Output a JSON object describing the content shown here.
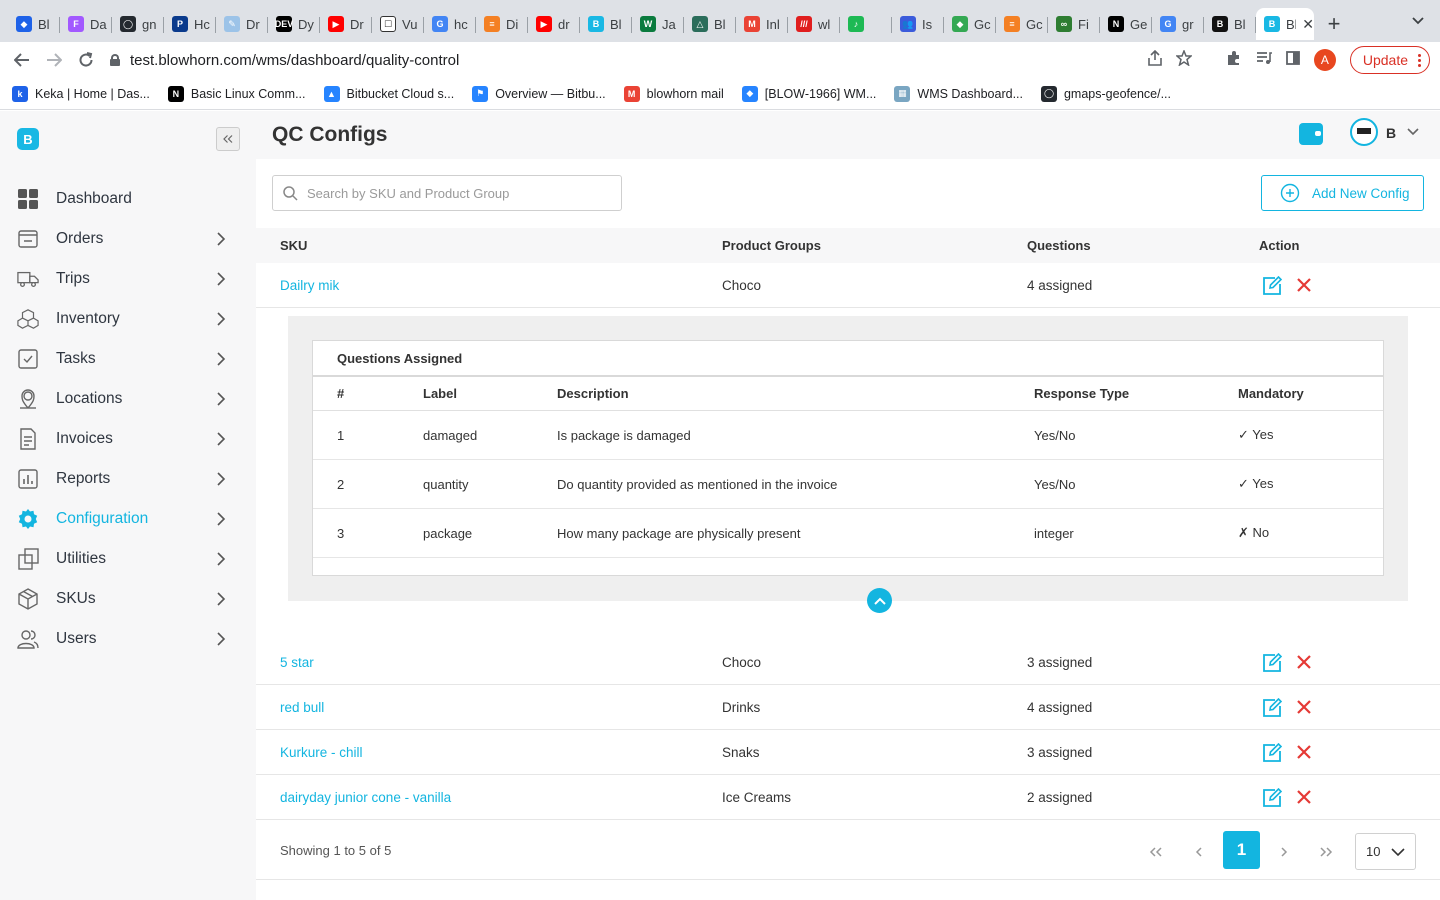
{
  "browser": {
    "tabs": [
      {
        "title": "Bl",
        "color": "#1e62e8",
        "glyph": "◆"
      },
      {
        "title": "Da",
        "color": "#a259ff",
        "glyph": "F"
      },
      {
        "title": "gn",
        "color": "#24292f",
        "glyph": "◯"
      },
      {
        "title": "Hc",
        "color": "#0a3a8c",
        "glyph": "P"
      },
      {
        "title": "Dr",
        "color": "#9cc3e8",
        "glyph": "✎"
      },
      {
        "title": "Dy",
        "color": "#000000",
        "glyph": "DEV"
      },
      {
        "title": "Dr",
        "color": "#ff0000",
        "glyph": "▶"
      },
      {
        "title": "Vu",
        "color": "#ffffff",
        "glyph": "☐"
      },
      {
        "title": "hc",
        "color": "#4285f4",
        "glyph": "G"
      },
      {
        "title": "Di",
        "color": "#f48024",
        "glyph": "≡"
      },
      {
        "title": "dr",
        "color": "#ff0000",
        "glyph": "▶"
      },
      {
        "title": "Bl",
        "color": "#19b8e4",
        "glyph": "B"
      },
      {
        "title": "Ja",
        "color": "#0a7b3e",
        "glyph": "W"
      },
      {
        "title": "Bl",
        "color": "#2b6d5b",
        "glyph": "△"
      },
      {
        "title": "Inl",
        "color": "#ea4335",
        "glyph": "M"
      },
      {
        "title": "wl",
        "color": "#e01e1e",
        "glyph": "///"
      },
      {
        "title": "",
        "color": "#1db954",
        "glyph": "♪"
      },
      {
        "title": "Is",
        "color": "#3b5bdb",
        "glyph": "👥"
      },
      {
        "title": "Gc",
        "color": "#34a853",
        "glyph": "◆"
      },
      {
        "title": "Gc",
        "color": "#f48024",
        "glyph": "≡"
      },
      {
        "title": "Fi",
        "color": "#2e7d32",
        "glyph": "∞"
      },
      {
        "title": "Ge",
        "color": "#000000",
        "glyph": "N"
      },
      {
        "title": "gr",
        "color": "#4285f4",
        "glyph": "G"
      },
      {
        "title": "Bl",
        "color": "#111111",
        "glyph": "B"
      },
      {
        "title": "Bl",
        "color": "#19b8e4",
        "glyph": "B",
        "active": true
      }
    ],
    "url": "test.blowhorn.com/wms/dashboard/quality-control",
    "profile_initial": "A",
    "update_label": "Update",
    "bookmarks": [
      {
        "label": "Keka | Home | Das...",
        "color": "#1e62e8",
        "glyph": "k"
      },
      {
        "label": "Basic Linux Comm...",
        "color": "#000000",
        "glyph": "N"
      },
      {
        "label": "Bitbucket Cloud s...",
        "color": "#2684ff",
        "glyph": "▲"
      },
      {
        "label": "Overview — Bitbu...",
        "color": "#2684ff",
        "glyph": "⚑"
      },
      {
        "label": "blowhorn mail",
        "color": "#ea4335",
        "glyph": "M"
      },
      {
        "label": "[BLOW-1966] WM...",
        "color": "#2684ff",
        "glyph": "◆"
      },
      {
        "label": "WMS Dashboard...",
        "color": "#7aa6c2",
        "glyph": "▦"
      },
      {
        "label": "gmaps-geofence/...",
        "color": "#24292f",
        "glyph": "◯"
      }
    ]
  },
  "sidebar": {
    "logo": "B",
    "items": [
      {
        "label": "Dashboard",
        "icon": "dashboard-icon",
        "chevron": false
      },
      {
        "label": "Orders",
        "icon": "orders-icon",
        "chevron": true
      },
      {
        "label": "Trips",
        "icon": "truck-icon",
        "chevron": true
      },
      {
        "label": "Inventory",
        "icon": "boxes-icon",
        "chevron": true
      },
      {
        "label": "Tasks",
        "icon": "tasks-icon",
        "chevron": true
      },
      {
        "label": "Locations",
        "icon": "location-icon",
        "chevron": true
      },
      {
        "label": "Invoices",
        "icon": "invoice-icon",
        "chevron": true
      },
      {
        "label": "Reports",
        "icon": "reports-icon",
        "chevron": true
      },
      {
        "label": "Configuration",
        "icon": "gear-icon",
        "chevron": true,
        "active": true
      },
      {
        "label": "Utilities",
        "icon": "utilities-icon",
        "chevron": true
      },
      {
        "label": "SKUs",
        "icon": "package-icon",
        "chevron": true
      },
      {
        "label": "Users",
        "icon": "users-icon",
        "chevron": true
      }
    ]
  },
  "header": {
    "title": "QC Configs",
    "user_initial": "B"
  },
  "search": {
    "placeholder": "Search by SKU and Product Group",
    "value": ""
  },
  "add_button_label": "Add New Config",
  "table": {
    "columns": [
      "SKU",
      "Product Groups",
      "Questions",
      "Action"
    ],
    "rows": [
      {
        "sku": "Dailry mik",
        "group": "Choco",
        "questions": "4 assigned",
        "expanded": true
      },
      {
        "sku": "5 star",
        "group": "Choco",
        "questions": "3 assigned"
      },
      {
        "sku": "red bull",
        "group": "Drinks",
        "questions": "4 assigned"
      },
      {
        "sku": "Kurkure - chill",
        "group": "Snaks",
        "questions": "3 assigned"
      },
      {
        "sku": "dairyday junior cone - vanilla",
        "group": "Ice Creams",
        "questions": "2 assigned"
      }
    ]
  },
  "questions_assigned": {
    "title": "Questions Assigned",
    "columns": [
      "#",
      "Label",
      "Description",
      "Response Type",
      "Mandatory"
    ],
    "rows": [
      {
        "num": "1",
        "label": "damaged",
        "description": "Is package is damaged",
        "response": "Yes/No",
        "mandatory": "✓ Yes"
      },
      {
        "num": "2",
        "label": "quantity",
        "description": "Do quantity provided as mentioned in the invoice",
        "response": "Yes/No",
        "mandatory": "✓ Yes"
      },
      {
        "num": "3",
        "label": "package",
        "description": "How many package are physically present",
        "response": "integer",
        "mandatory": "✗ No"
      }
    ]
  },
  "pagination": {
    "showing": "Showing 1 to 5 of 5",
    "current_page": "1",
    "page_size": "10"
  },
  "colors": {
    "accent": "#13b5e0",
    "danger": "#e53935"
  }
}
